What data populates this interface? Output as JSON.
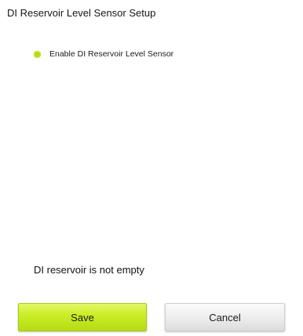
{
  "dialog": {
    "title": "DI Reservoir Level Sensor Setup"
  },
  "options": {
    "enable_sensor": {
      "label": "Enable DI Reservoir Level Sensor",
      "selected": true,
      "indicator_color": "#b6dc18"
    }
  },
  "status": {
    "text": "DI reservoir is not empty"
  },
  "buttons": {
    "save_label": "Save",
    "cancel_label": "Cancel",
    "save_color": "#c6ea22"
  }
}
